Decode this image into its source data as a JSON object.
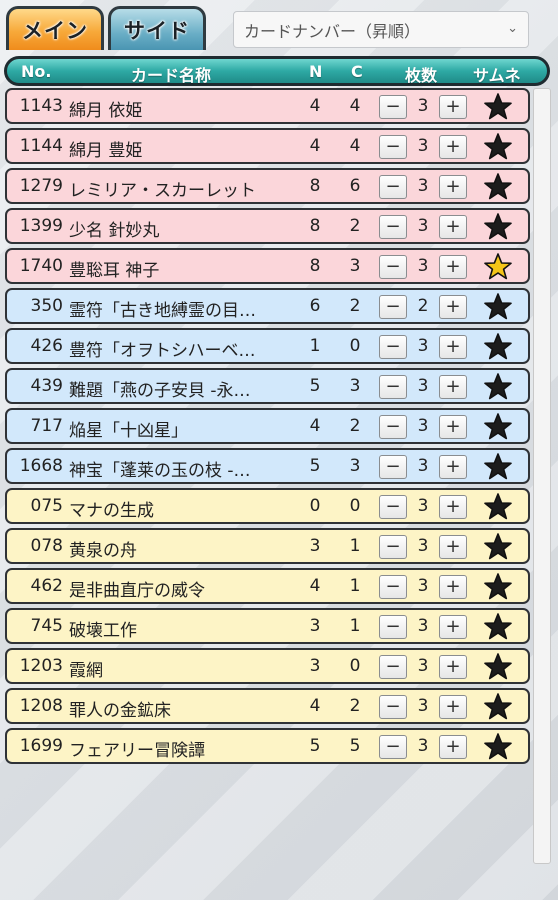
{
  "tabs": {
    "main": "メイン",
    "side": "サイド"
  },
  "sort": {
    "selected": "カードナンバー（昇順）"
  },
  "header": {
    "no": "No.",
    "name": "カード名称",
    "n": "N",
    "c": "C",
    "count": "枚数",
    "thumb": "サムネ"
  },
  "colors": {
    "pink": "#fbd6da",
    "blue": "#d2e8fb",
    "yellow": "#fdf4c6",
    "header": "#2ea9a4",
    "star_active": "#f5c518"
  },
  "rows": [
    {
      "no": "1143",
      "name": "綿月 依姫",
      "n": "4",
      "c": "4",
      "count": "3",
      "color": "pink",
      "star": "dark"
    },
    {
      "no": "1144",
      "name": "綿月 豊姫",
      "n": "4",
      "c": "4",
      "count": "3",
      "color": "pink",
      "star": "dark"
    },
    {
      "no": "1279",
      "name": "レミリア・スカーレット",
      "n": "8",
      "c": "6",
      "count": "3",
      "color": "pink",
      "star": "dark"
    },
    {
      "no": "1399",
      "name": "少名 針妙丸",
      "n": "8",
      "c": "2",
      "count": "3",
      "color": "pink",
      "star": "dark"
    },
    {
      "no": "1740",
      "name": "豊聡耳 神子",
      "n": "8",
      "c": "3",
      "count": "3",
      "color": "pink",
      "star": "gold"
    },
    {
      "no": "350",
      "name": "霊符「古き地縛霊の目…",
      "n": "6",
      "c": "2",
      "count": "2",
      "color": "blue",
      "star": "dark"
    },
    {
      "no": "426",
      "name": "豊符「オヲトシハーベ…",
      "n": "1",
      "c": "0",
      "count": "3",
      "color": "blue",
      "star": "dark"
    },
    {
      "no": "439",
      "name": "難題「燕の子安貝 -永…",
      "n": "5",
      "c": "3",
      "count": "3",
      "color": "blue",
      "star": "dark"
    },
    {
      "no": "717",
      "name": "焔星「十凶星」",
      "n": "4",
      "c": "2",
      "count": "3",
      "color": "blue",
      "star": "dark"
    },
    {
      "no": "1668",
      "name": "神宝「蓬莱の玉の枝 -…",
      "n": "5",
      "c": "3",
      "count": "3",
      "color": "blue",
      "star": "dark"
    },
    {
      "no": "075",
      "name": "マナの生成",
      "n": "0",
      "c": "0",
      "count": "3",
      "color": "yellow",
      "star": "dark"
    },
    {
      "no": "078",
      "name": "黄泉の舟",
      "n": "3",
      "c": "1",
      "count": "3",
      "color": "yellow",
      "star": "dark"
    },
    {
      "no": "462",
      "name": "是非曲直庁の威令",
      "n": "4",
      "c": "1",
      "count": "3",
      "color": "yellow",
      "star": "dark"
    },
    {
      "no": "745",
      "name": "破壊工作",
      "n": "3",
      "c": "1",
      "count": "3",
      "color": "yellow",
      "star": "dark"
    },
    {
      "no": "1203",
      "name": "霞網",
      "n": "3",
      "c": "0",
      "count": "3",
      "color": "yellow",
      "star": "dark"
    },
    {
      "no": "1208",
      "name": "罪人の金鉱床",
      "n": "4",
      "c": "2",
      "count": "3",
      "color": "yellow",
      "star": "dark"
    },
    {
      "no": "1699",
      "name": "フェアリー冒険譚",
      "n": "5",
      "c": "5",
      "count": "3",
      "color": "yellow",
      "star": "dark"
    }
  ],
  "buttons": {
    "minus": "−",
    "plus": "+"
  }
}
